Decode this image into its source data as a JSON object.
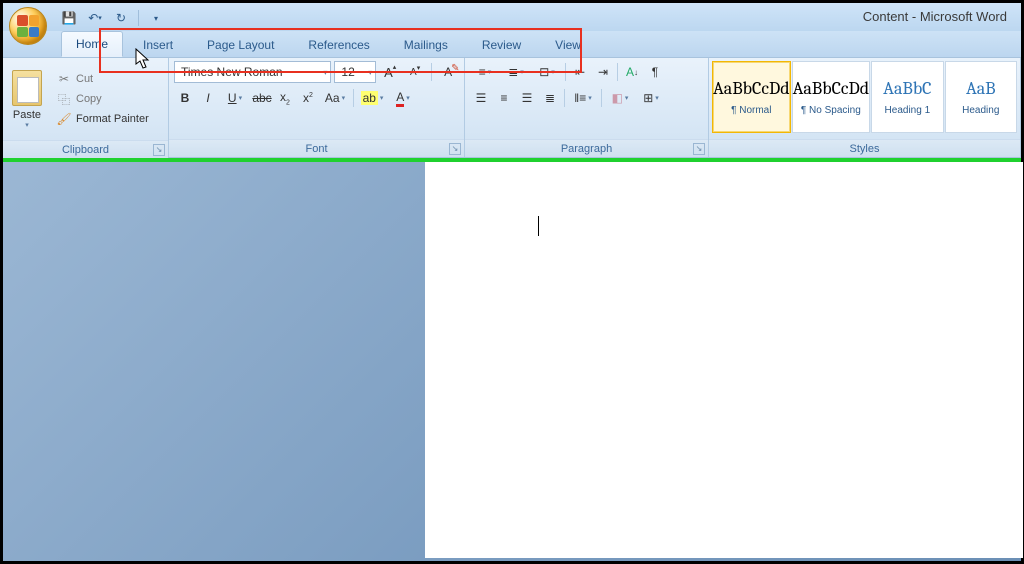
{
  "title": "Content - Microsoft Word",
  "qat": {
    "save": "save",
    "undo": "undo",
    "redo": "redo"
  },
  "tabs": {
    "home": "Home",
    "insert": "Insert",
    "pagelayout": "Page Layout",
    "references": "References",
    "mailings": "Mailings",
    "review": "Review",
    "view": "View"
  },
  "clipboard": {
    "label": "Clipboard",
    "paste": "Paste",
    "cut": "Cut",
    "copy": "Copy",
    "fmtpainter": "Format Painter"
  },
  "font": {
    "label": "Font",
    "name": "Times New Roman",
    "size": "12",
    "bold": "B",
    "italic": "I",
    "underline": "U",
    "strike": "abc",
    "sub": "x",
    "sup": "x",
    "case": "Aa",
    "clear": "A"
  },
  "para": {
    "label": "Paragraph"
  },
  "styles": {
    "label": "Styles",
    "items": [
      {
        "preview": "AaBbCcDd",
        "name": "¶ Normal",
        "sel": true,
        "blue": false
      },
      {
        "preview": "AaBbCcDd",
        "name": "¶ No Spacing",
        "sel": false,
        "blue": false
      },
      {
        "preview": "AaBbC",
        "name": "Heading 1",
        "sel": false,
        "blue": true
      },
      {
        "preview": "AaB",
        "name": "Heading",
        "sel": false,
        "blue": true
      }
    ]
  }
}
